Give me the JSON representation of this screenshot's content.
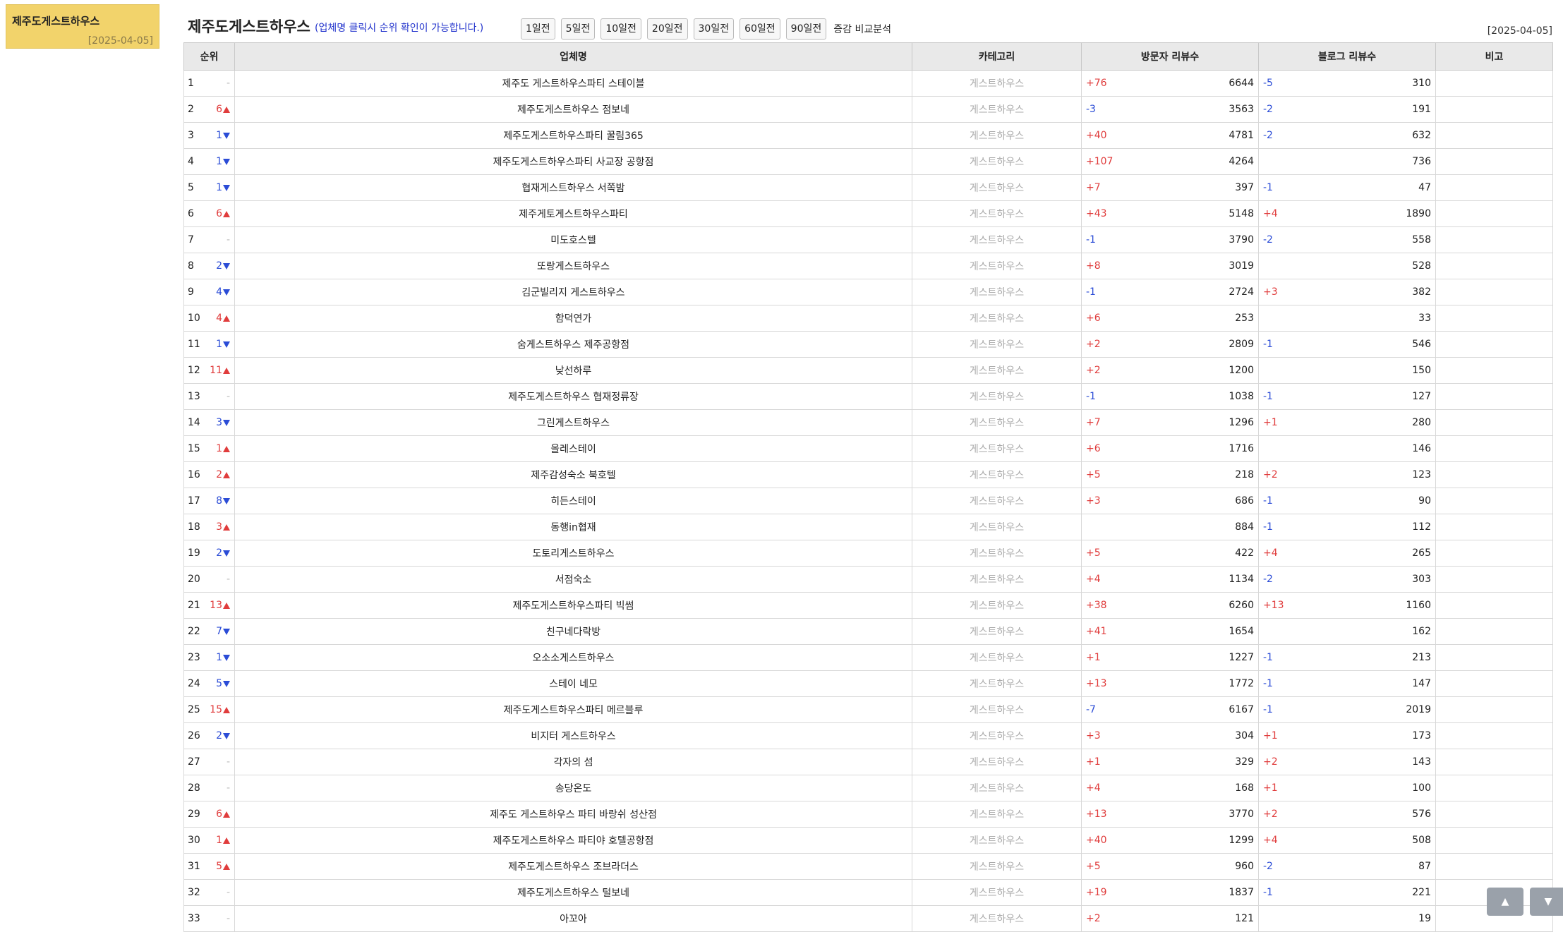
{
  "sidebar": {
    "title": "제주도게스트하우스",
    "date": "[2025-04-05]"
  },
  "header": {
    "title": "제주도게스트하우스",
    "hint": "(업체명 클릭시 순위 확인이 가능합니다.)",
    "period_buttons": [
      "1일전",
      "5일전",
      "10일전",
      "20일전",
      "30일전",
      "60일전",
      "90일전"
    ],
    "compare_label": "증감 비교분석",
    "date": "[2025-04-05]"
  },
  "table": {
    "headers": {
      "rank": "순위",
      "name": "업체명",
      "category": "카테고리",
      "visitor_reviews": "방문자 리뷰수",
      "blog_reviews": "블로그 리뷰수",
      "note": "비고"
    },
    "rows": [
      {
        "rank": "1",
        "change": "-",
        "dir": "none",
        "name": "제주도 게스트하우스파티 스테이블",
        "category": "게스트하우스",
        "visitor_delta": "+76",
        "visitor_total": "6644",
        "blog_delta": "-5",
        "blog_total": "310"
      },
      {
        "rank": "2",
        "change": "6",
        "dir": "up",
        "name": "제주도게스트하우스 점보네",
        "category": "게스트하우스",
        "visitor_delta": "-3",
        "visitor_total": "3563",
        "blog_delta": "-2",
        "blog_total": "191"
      },
      {
        "rank": "3",
        "change": "1",
        "dir": "down",
        "name": "제주도게스트하우스파티 꿀림365",
        "category": "게스트하우스",
        "visitor_delta": "+40",
        "visitor_total": "4781",
        "blog_delta": "-2",
        "blog_total": "632"
      },
      {
        "rank": "4",
        "change": "1",
        "dir": "down",
        "name": "제주도게스트하우스파티 사교장 공항점",
        "category": "게스트하우스",
        "visitor_delta": "+107",
        "visitor_total": "4264",
        "blog_delta": "",
        "blog_total": "736"
      },
      {
        "rank": "5",
        "change": "1",
        "dir": "down",
        "name": "협재게스트하우스 서쪽밤",
        "category": "게스트하우스",
        "visitor_delta": "+7",
        "visitor_total": "397",
        "blog_delta": "-1",
        "blog_total": "47"
      },
      {
        "rank": "6",
        "change": "6",
        "dir": "up",
        "name": "제주게토게스트하우스파티",
        "category": "게스트하우스",
        "visitor_delta": "+43",
        "visitor_total": "5148",
        "blog_delta": "+4",
        "blog_total": "1890"
      },
      {
        "rank": "7",
        "change": "-",
        "dir": "none",
        "name": "미도호스텔",
        "category": "게스트하우스",
        "visitor_delta": "-1",
        "visitor_total": "3790",
        "blog_delta": "-2",
        "blog_total": "558"
      },
      {
        "rank": "8",
        "change": "2",
        "dir": "down",
        "name": "또랑게스트하우스",
        "category": "게스트하우스",
        "visitor_delta": "+8",
        "visitor_total": "3019",
        "blog_delta": "",
        "blog_total": "528"
      },
      {
        "rank": "9",
        "change": "4",
        "dir": "down",
        "name": "김군빌리지 게스트하우스",
        "category": "게스트하우스",
        "visitor_delta": "-1",
        "visitor_total": "2724",
        "blog_delta": "+3",
        "blog_total": "382"
      },
      {
        "rank": "10",
        "change": "4",
        "dir": "up",
        "name": "함덕연가",
        "category": "게스트하우스",
        "visitor_delta": "+6",
        "visitor_total": "253",
        "blog_delta": "",
        "blog_total": "33"
      },
      {
        "rank": "11",
        "change": "1",
        "dir": "down",
        "name": "숨게스트하우스 제주공항점",
        "category": "게스트하우스",
        "visitor_delta": "+2",
        "visitor_total": "2809",
        "blog_delta": "-1",
        "blog_total": "546"
      },
      {
        "rank": "12",
        "change": "11",
        "dir": "up",
        "name": "낮선하루",
        "category": "게스트하우스",
        "visitor_delta": "+2",
        "visitor_total": "1200",
        "blog_delta": "",
        "blog_total": "150"
      },
      {
        "rank": "13",
        "change": "-",
        "dir": "none",
        "name": "제주도게스트하우스 협재정류장",
        "category": "게스트하우스",
        "visitor_delta": "-1",
        "visitor_total": "1038",
        "blog_delta": "-1",
        "blog_total": "127"
      },
      {
        "rank": "14",
        "change": "3",
        "dir": "down",
        "name": "그린게스트하우스",
        "category": "게스트하우스",
        "visitor_delta": "+7",
        "visitor_total": "1296",
        "blog_delta": "+1",
        "blog_total": "280"
      },
      {
        "rank": "15",
        "change": "1",
        "dir": "up",
        "name": "올레스테이",
        "category": "게스트하우스",
        "visitor_delta": "+6",
        "visitor_total": "1716",
        "blog_delta": "",
        "blog_total": "146"
      },
      {
        "rank": "16",
        "change": "2",
        "dir": "up",
        "name": "제주감성숙소 북호텔",
        "category": "게스트하우스",
        "visitor_delta": "+5",
        "visitor_total": "218",
        "blog_delta": "+2",
        "blog_total": "123"
      },
      {
        "rank": "17",
        "change": "8",
        "dir": "down",
        "name": "히든스테이",
        "category": "게스트하우스",
        "visitor_delta": "+3",
        "visitor_total": "686",
        "blog_delta": "-1",
        "blog_total": "90"
      },
      {
        "rank": "18",
        "change": "3",
        "dir": "up",
        "name": "동행in협재",
        "category": "게스트하우스",
        "visitor_delta": "",
        "visitor_total": "884",
        "blog_delta": "-1",
        "blog_total": "112"
      },
      {
        "rank": "19",
        "change": "2",
        "dir": "down",
        "name": "도토리게스트하우스",
        "category": "게스트하우스",
        "visitor_delta": "+5",
        "visitor_total": "422",
        "blog_delta": "+4",
        "blog_total": "265"
      },
      {
        "rank": "20",
        "change": "-",
        "dir": "none",
        "name": "서점숙소",
        "category": "게스트하우스",
        "visitor_delta": "+4",
        "visitor_total": "1134",
        "blog_delta": "-2",
        "blog_total": "303"
      },
      {
        "rank": "21",
        "change": "13",
        "dir": "up",
        "name": "제주도게스트하우스파티 빅썸",
        "category": "게스트하우스",
        "visitor_delta": "+38",
        "visitor_total": "6260",
        "blog_delta": "+13",
        "blog_total": "1160"
      },
      {
        "rank": "22",
        "change": "7",
        "dir": "down",
        "name": "친구네다락방",
        "category": "게스트하우스",
        "visitor_delta": "+41",
        "visitor_total": "1654",
        "blog_delta": "",
        "blog_total": "162"
      },
      {
        "rank": "23",
        "change": "1",
        "dir": "down",
        "name": "오소소게스트하우스",
        "category": "게스트하우스",
        "visitor_delta": "+1",
        "visitor_total": "1227",
        "blog_delta": "-1",
        "blog_total": "213"
      },
      {
        "rank": "24",
        "change": "5",
        "dir": "down",
        "name": "스테이 네모",
        "category": "게스트하우스",
        "visitor_delta": "+13",
        "visitor_total": "1772",
        "blog_delta": "-1",
        "blog_total": "147"
      },
      {
        "rank": "25",
        "change": "15",
        "dir": "up",
        "name": "제주도게스트하우스파티 메르블루",
        "category": "게스트하우스",
        "visitor_delta": "-7",
        "visitor_total": "6167",
        "blog_delta": "-1",
        "blog_total": "2019"
      },
      {
        "rank": "26",
        "change": "2",
        "dir": "down",
        "name": "비지터 게스트하우스",
        "category": "게스트하우스",
        "visitor_delta": "+3",
        "visitor_total": "304",
        "blog_delta": "+1",
        "blog_total": "173"
      },
      {
        "rank": "27",
        "change": "-",
        "dir": "none",
        "name": "각자의 섬",
        "category": "게스트하우스",
        "visitor_delta": "+1",
        "visitor_total": "329",
        "blog_delta": "+2",
        "blog_total": "143"
      },
      {
        "rank": "28",
        "change": "-",
        "dir": "none",
        "name": "송당온도",
        "category": "게스트하우스",
        "visitor_delta": "+4",
        "visitor_total": "168",
        "blog_delta": "+1",
        "blog_total": "100"
      },
      {
        "rank": "29",
        "change": "6",
        "dir": "up",
        "name": "제주도 게스트하우스 파티 바랑쉬 성산점",
        "category": "게스트하우스",
        "visitor_delta": "+13",
        "visitor_total": "3770",
        "blog_delta": "+2",
        "blog_total": "576"
      },
      {
        "rank": "30",
        "change": "1",
        "dir": "up",
        "name": "제주도게스트하우스 파티야 호텔공항점",
        "category": "게스트하우스",
        "visitor_delta": "+40",
        "visitor_total": "1299",
        "blog_delta": "+4",
        "blog_total": "508"
      },
      {
        "rank": "31",
        "change": "5",
        "dir": "up",
        "name": "제주도게스트하우스 조브라더스",
        "category": "게스트하우스",
        "visitor_delta": "+5",
        "visitor_total": "960",
        "blog_delta": "-2",
        "blog_total": "87"
      },
      {
        "rank": "32",
        "change": "-",
        "dir": "none",
        "name": "제주도게스트하우스 털보네",
        "category": "게스트하우스",
        "visitor_delta": "+19",
        "visitor_total": "1837",
        "blog_delta": "-1",
        "blog_total": "221"
      },
      {
        "rank": "33",
        "change": "-",
        "dir": "none",
        "name": "아꼬아",
        "category": "게스트하우스",
        "visitor_delta": "+2",
        "visitor_total": "121",
        "blog_delta": "",
        "blog_total": "19"
      }
    ]
  },
  "scroll": {
    "up_icon": "triangle-up-icon",
    "down_icon": "triangle-down-icon",
    "up_glyph": "▲",
    "down_glyph": "▼"
  },
  "colors": {
    "sidebar_bg": "#f2d36b",
    "up": "#e03c3c",
    "down": "#2b4cd6",
    "hint": "#2233cc"
  }
}
